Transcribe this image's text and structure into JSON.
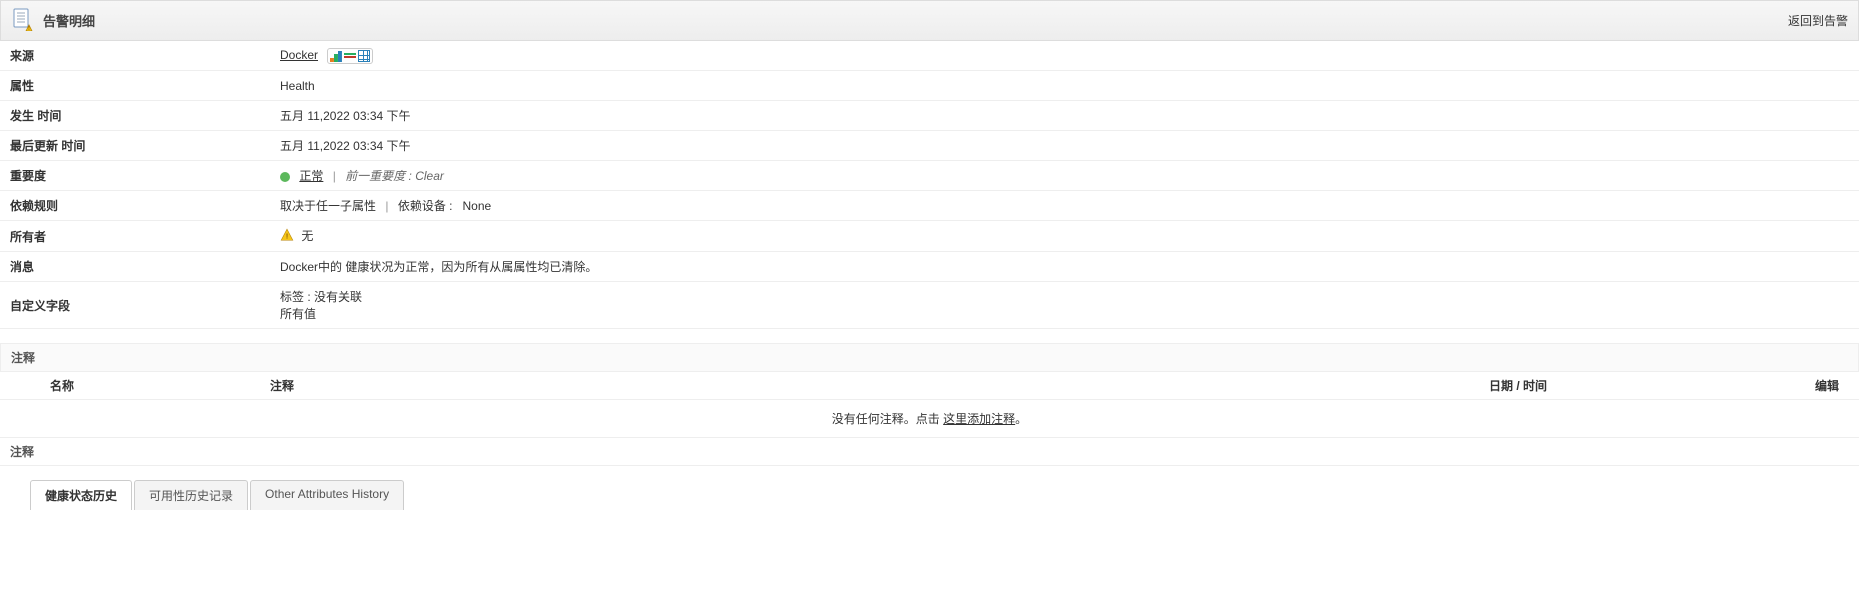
{
  "header": {
    "title": "告警明细",
    "back_link": "返回到告警"
  },
  "details": {
    "source_label": "来源",
    "source_value": "Docker",
    "attribute_label": "属性",
    "attribute_value": "Health",
    "occurred_label": "发生  时间",
    "occurred_value": "五月 11,2022 03:34 下午",
    "updated_label": "最后更新  时间",
    "updated_value": "五月 11,2022 03:34 下午",
    "severity_label": "重要度",
    "severity_value": "正常",
    "prev_severity_label": "前一重要度 :",
    "prev_severity_value": "Clear",
    "dependency_label": "依赖规则",
    "dependency_rule": "取决于任一子属性",
    "dependency_device_label": "依赖设备 :",
    "dependency_device_value": "None",
    "owner_label": "所有者",
    "owner_value": "无",
    "message_label": "消息",
    "message_value": "Docker中的 健康状况为正常，因为所有从属属性均已清除。",
    "custom_label": "自定义字段",
    "custom_tag_label": "标签 :",
    "custom_tag_value": "没有关联",
    "custom_allvalues": "所有值"
  },
  "annotations": {
    "section_title": "注释",
    "col_name": "名称",
    "col_anno": "注释",
    "col_date": "日期 / 时间",
    "col_edit": "编辑",
    "empty_prefix": "没有任何注释。点击",
    "empty_link": "这里添加注释",
    "empty_suffix": "。",
    "section_title2": "注释"
  },
  "tabs": {
    "tab1": "健康状态历史",
    "tab2": "可用性历史记录",
    "tab3": "Other Attributes History"
  }
}
